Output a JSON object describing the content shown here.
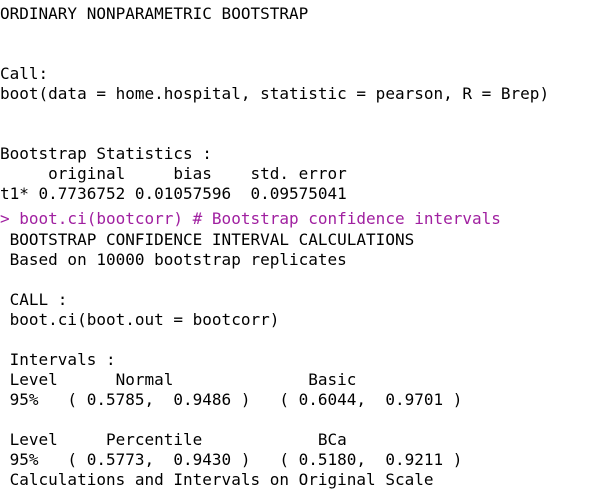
{
  "colors": {
    "background": "#ffffff",
    "output_text": "#000000",
    "command_text": "#a020a0"
  },
  "bootstrap_output": {
    "header": "ORDINARY NONPARAMETRIC BOOTSTRAP",
    "call_label": "Call:",
    "call_text": "boot(data = home.hospital, statistic = pearson, R = Brep)",
    "stats_label": "Bootstrap Statistics :",
    "stats_columns": "     original     bias    std. error",
    "stats_row": "t1* 0.7736752 0.01057596  0.09575041"
  },
  "command": {
    "text": "> boot.ci(bootcorr) # Bootstrap confidence intervals"
  },
  "ci_output": {
    "title": " BOOTSTRAP CONFIDENCE INTERVAL CALCULATIONS",
    "replicates": " Based on 10000 bootstrap replicates",
    "call_label": " CALL :",
    "call_text": " boot.ci(boot.out = bootcorr)",
    "intervals_label": " Intervals :",
    "row1_header": " Level      Normal              Basic",
    "row1_values": " 95%   ( 0.5785,  0.9486 )   ( 0.6044,  0.9701 )",
    "row2_header": " Level     Percentile            BCa",
    "row2_values": " 95%   ( 0.5773,  0.9430 )   ( 0.5180,  0.9211 )",
    "footer": " Calculations and Intervals on Original Scale"
  }
}
